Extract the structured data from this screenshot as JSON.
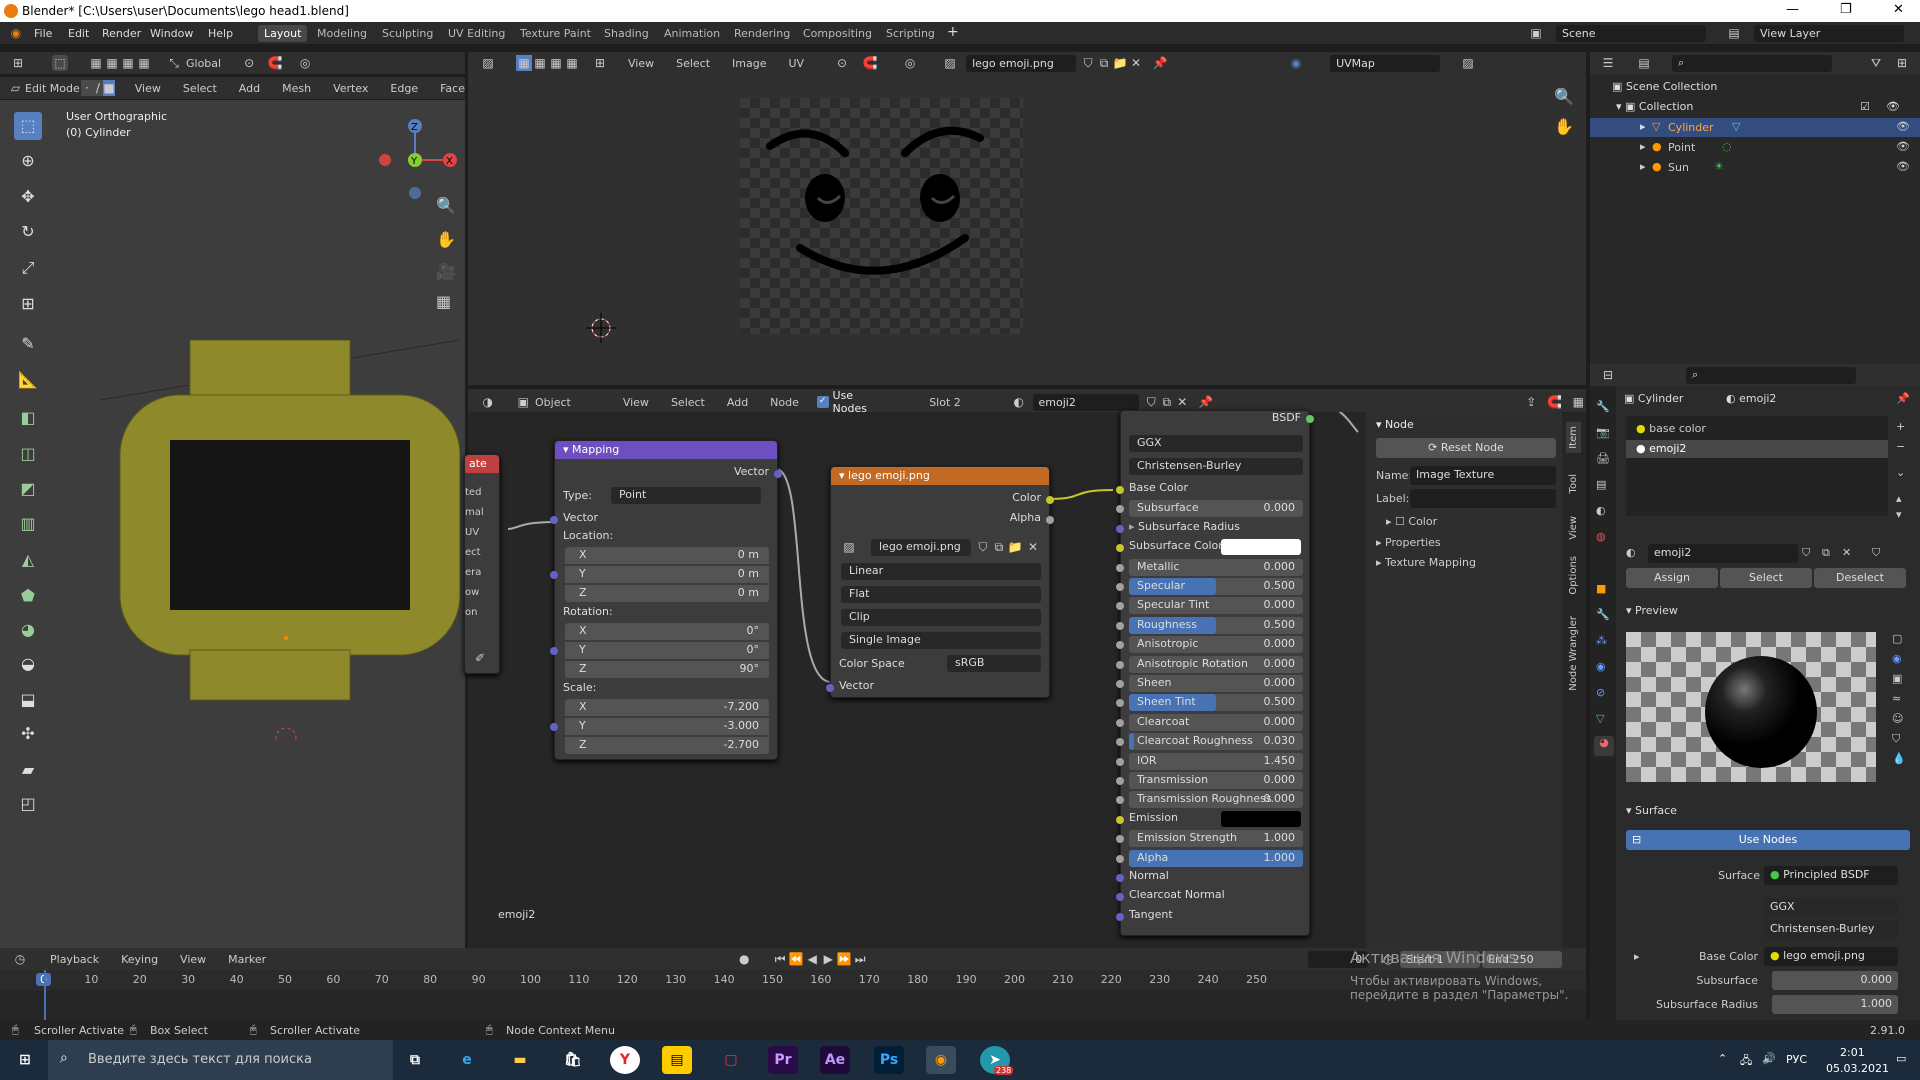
{
  "window": {
    "title": "Blender* [C:\\Users\\user\\Documents\\lego head1.blend]",
    "minimize": "—",
    "maximize": "❐",
    "close": "✕"
  },
  "menu": {
    "items": [
      "File",
      "Edit",
      "Render",
      "Window",
      "Help"
    ],
    "workspaces": [
      "Layout",
      "Modeling",
      "Sculpting",
      "UV Editing",
      "Texture Paint",
      "Shading",
      "Animation",
      "Rendering",
      "Compositing",
      "Scripting"
    ],
    "add_workspace": "+",
    "scene": "Scene",
    "view_layer": "View Layer"
  },
  "viewport3d": {
    "mode": "Edit Mode",
    "menus": [
      "View",
      "Select",
      "Add",
      "Mesh",
      "Vertex",
      "Edge",
      "Face"
    ],
    "transform": "Global",
    "overlay_line1": "User Orthographic",
    "overlay_line2": "(0) Cylinder",
    "axis_x": "X",
    "axis_y": "Y",
    "axis_z": "Z"
  },
  "image_editor": {
    "menus": [
      "View",
      "Select",
      "Image",
      "UV"
    ],
    "image_name": "lego emoji.png",
    "uvmap": "UVMap"
  },
  "node_editor": {
    "object": "Object",
    "menus": [
      "View",
      "Select",
      "Add",
      "Node"
    ],
    "use_nodes": "Use Nodes",
    "slot": "Slot 2",
    "material": "emoji2",
    "footer_label": "emoji2",
    "left_partial": {
      "title": "ate",
      "labels": [
        "ted",
        "mal",
        "UV",
        "ect",
        "era",
        "ow",
        "on"
      ]
    },
    "mapping": {
      "title": "Mapping",
      "out_vector": "Vector",
      "type_label": "Type:",
      "type_value": "Point",
      "in_vector": "Vector",
      "location_label": "Location:",
      "loc": [
        {
          "axis": "X",
          "value": "0 m"
        },
        {
          "axis": "Y",
          "value": "0 m"
        },
        {
          "axis": "Z",
          "value": "0 m"
        }
      ],
      "rotation_label": "Rotation:",
      "rot": [
        {
          "axis": "X",
          "value": "0°"
        },
        {
          "axis": "Y",
          "value": "0°"
        },
        {
          "axis": "Z",
          "value": "90°"
        }
      ],
      "scale_label": "Scale:",
      "scale": [
        {
          "axis": "X",
          "value": "-7.200"
        },
        {
          "axis": "Y",
          "value": "-3.000"
        },
        {
          "axis": "Z",
          "value": "-2.700"
        }
      ]
    },
    "image_tex": {
      "title": "lego emoji.png",
      "out_color": "Color",
      "out_alpha": "Alpha",
      "image": "lego emoji.png",
      "interp": "Linear",
      "proj": "Flat",
      "ext": "Clip",
      "source": "Single Image",
      "cs_label": "Color Space",
      "cs_value": "sRGB",
      "in_vector": "Vector"
    },
    "bsdf": {
      "title": "BSDF",
      "dist": "GGX",
      "sss": "Christensen-Burley",
      "rows": [
        {
          "label": "Base Color",
          "value": "",
          "type": "socket",
          "sock": "#c7c729"
        },
        {
          "label": "Subsurface",
          "value": "0.000",
          "type": "num",
          "sock": "#a1a1a1"
        },
        {
          "label": "Subsurface Radius",
          "value": "",
          "type": "drop",
          "sock": "#6363c7"
        },
        {
          "label": "Subsurface Color",
          "value": "",
          "type": "white",
          "sock": "#c7c729"
        },
        {
          "label": "Metallic",
          "value": "0.000",
          "type": "num",
          "sock": "#a1a1a1"
        },
        {
          "label": "Specular",
          "value": "0.500",
          "type": "half",
          "sock": "#a1a1a1"
        },
        {
          "label": "Specular Tint",
          "value": "0.000",
          "type": "num",
          "sock": "#a1a1a1"
        },
        {
          "label": "Roughness",
          "value": "0.500",
          "type": "half",
          "sock": "#a1a1a1"
        },
        {
          "label": "Anisotropic",
          "value": "0.000",
          "type": "num",
          "sock": "#a1a1a1"
        },
        {
          "label": "Anisotropic Rotation",
          "value": "0.000",
          "type": "num",
          "sock": "#a1a1a1"
        },
        {
          "label": "Sheen",
          "value": "0.000",
          "type": "num",
          "sock": "#a1a1a1"
        },
        {
          "label": "Sheen Tint",
          "value": "0.500",
          "type": "half",
          "sock": "#a1a1a1"
        },
        {
          "label": "Clearcoat",
          "value": "0.000",
          "type": "num",
          "sock": "#a1a1a1"
        },
        {
          "label": "Clearcoat Roughness",
          "value": "0.030",
          "type": "low",
          "sock": "#a1a1a1"
        },
        {
          "label": "IOR",
          "value": "1.450",
          "type": "num",
          "sock": "#a1a1a1"
        },
        {
          "label": "Transmission",
          "value": "0.000",
          "type": "num",
          "sock": "#a1a1a1"
        },
        {
          "label": "Transmission Roughness",
          "value": "0.000",
          "type": "num",
          "sock": "#a1a1a1"
        },
        {
          "label": "Emission",
          "value": "",
          "type": "black",
          "sock": "#c7c729"
        },
        {
          "label": "Emission Strength",
          "value": "1.000",
          "type": "num",
          "sock": "#a1a1a1"
        },
        {
          "label": "Alpha",
          "value": "1.000",
          "type": "full",
          "sock": "#a1a1a1"
        },
        {
          "label": "Normal",
          "value": "",
          "type": "socket",
          "sock": "#6363c7"
        },
        {
          "label": "Clearcoat Normal",
          "value": "",
          "type": "socket",
          "sock": "#6363c7"
        },
        {
          "label": "Tangent",
          "value": "",
          "type": "socket",
          "sock": "#6363c7"
        }
      ]
    },
    "sidebar": {
      "section": "Node",
      "reset": "Reset Node",
      "name_label": "Name:",
      "name_value": "Image Texture",
      "label_label": "Label:",
      "color": "Color",
      "properties": "Properties",
      "texture_mapping": "Texture Mapping",
      "tabs": [
        "Item",
        "Tool",
        "View",
        "Options",
        "Node Wrangler"
      ]
    }
  },
  "outliner": {
    "title": "Scene Collection",
    "collection": "Collection",
    "items": [
      "Cylinder",
      "Point",
      "Sun"
    ]
  },
  "properties": {
    "object": "Cylinder",
    "material": "emoji2",
    "slots": [
      "base color",
      "emoji2"
    ],
    "mat_field": "emoji2",
    "assign": "Assign",
    "select": "Select",
    "deselect": "Deselect",
    "preview": "Preview",
    "surface": "Surface",
    "use_nodes": "Use Nodes",
    "surface_label": "Surface",
    "surface_value": "Principled BSDF",
    "dist": "GGX",
    "sss": "Christensen-Burley",
    "base_color_label": "Base Color",
    "base_color_value": "lego emoji.png",
    "subsurface_label": "Subsurface",
    "subsurface_value": "0.000",
    "sss_radius_label": "Subsurface Radius",
    "sss_radius_value": "1.000"
  },
  "timeline": {
    "menus": [
      "Playback",
      "Keying",
      "View",
      "Marker"
    ],
    "current": "0",
    "start_label": "Start",
    "start": "1",
    "end_label": "End",
    "end": "250",
    "ticks": [
      "0",
      "10",
      "20",
      "30",
      "40",
      "50",
      "60",
      "70",
      "80",
      "90",
      "100",
      "110",
      "120",
      "130",
      "140",
      "150",
      "160",
      "170",
      "180",
      "190",
      "200",
      "210",
      "220",
      "230",
      "240",
      "250"
    ],
    "activation1": "Активация Windows",
    "activation2": "Чтобы активировать Windows, перейдите в раздел \"Параметры\"."
  },
  "status": {
    "left": "Scroller Activate",
    "box": "Box Select",
    "scroller": "Scroller Activate",
    "context": "Node Context Menu",
    "version": "2.91.0"
  },
  "taskbar": {
    "search": "Введите здесь текст для поиска",
    "lang": "РУС",
    "time": "2:01",
    "date": "05.03.2021",
    "badge": "238",
    "apps": [
      "Pr",
      "Ae",
      "Ps"
    ]
  }
}
